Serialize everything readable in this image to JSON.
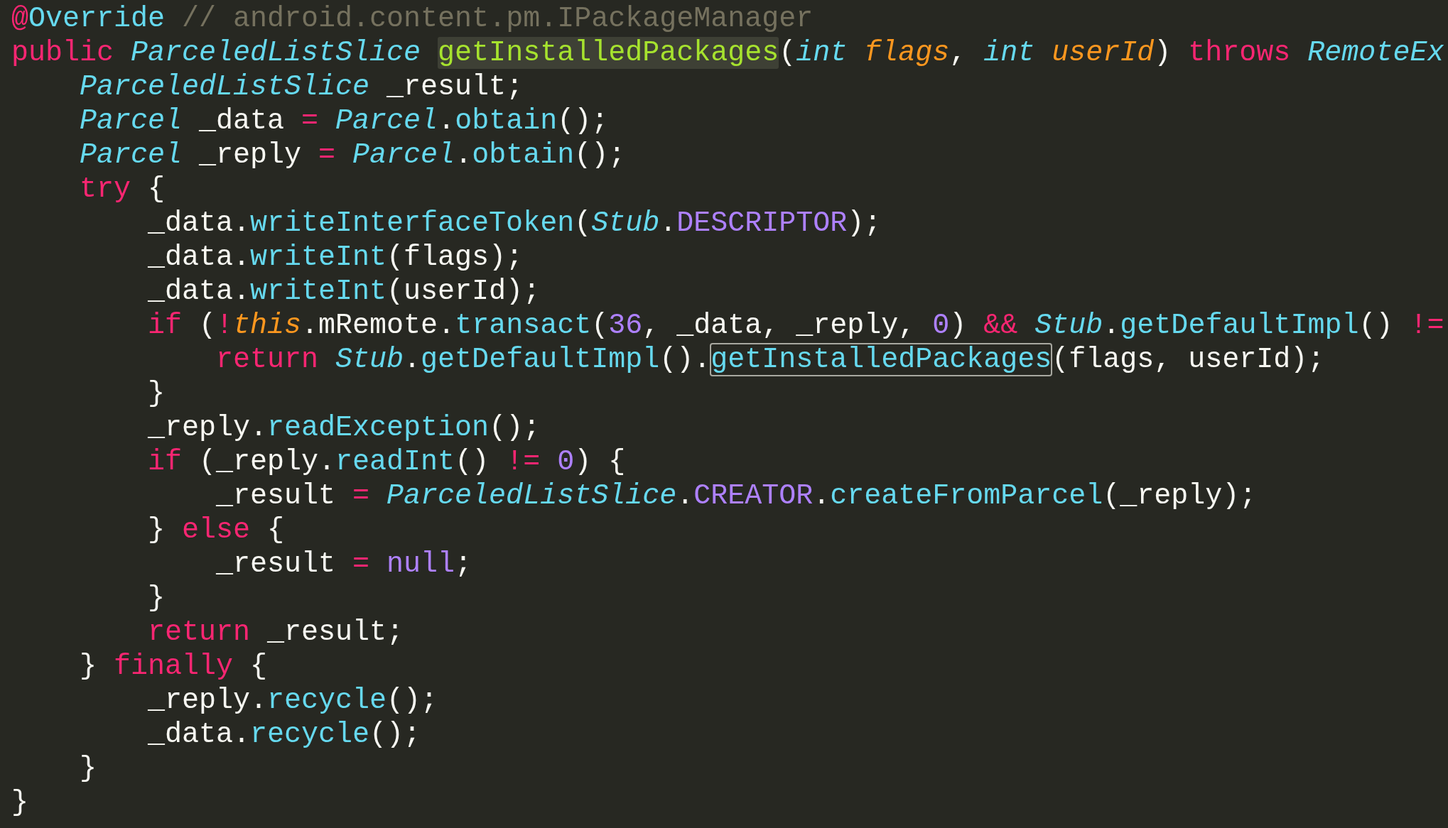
{
  "editor": {
    "lines": [
      {
        "tokens": [
          {
            "text": "@",
            "kind": "keyword"
          },
          {
            "text": "Override",
            "kind": "call"
          },
          {
            "text": " // android.content.pm.IPackageManager",
            "kind": "comment"
          }
        ]
      },
      {
        "tokens": [
          {
            "text": "public ",
            "kind": "keyword"
          },
          {
            "text": "ParceledListSlice ",
            "kind": "type"
          },
          {
            "text": "getInstalledPackages",
            "kind": "decl-selected"
          },
          {
            "text": "(",
            "kind": "plain"
          },
          {
            "text": "int ",
            "kind": "type"
          },
          {
            "text": "flags",
            "kind": "param"
          },
          {
            "text": ", ",
            "kind": "plain"
          },
          {
            "text": "int ",
            "kind": "type"
          },
          {
            "text": "userId",
            "kind": "param"
          },
          {
            "text": ") ",
            "kind": "plain"
          },
          {
            "text": "throws ",
            "kind": "keyword"
          },
          {
            "text": "RemoteEx",
            "kind": "type"
          }
        ],
        "children": [
          {
            "tokens": [
              {
                "text": "ParceledListSlice",
                "kind": "type"
              },
              {
                "text": " _result;",
                "kind": "plain"
              }
            ]
          },
          {
            "tokens": [
              {
                "text": "Parcel",
                "kind": "type"
              },
              {
                "text": " _data ",
                "kind": "plain"
              },
              {
                "text": "= ",
                "kind": "keyword"
              },
              {
                "text": "Parcel",
                "kind": "type"
              },
              {
                "text": ".",
                "kind": "plain"
              },
              {
                "text": "obtain",
                "kind": "call"
              },
              {
                "text": "();",
                "kind": "plain"
              }
            ]
          },
          {
            "tokens": [
              {
                "text": "Parcel",
                "kind": "type"
              },
              {
                "text": " _reply ",
                "kind": "plain"
              },
              {
                "text": "= ",
                "kind": "keyword"
              },
              {
                "text": "Parcel",
                "kind": "type"
              },
              {
                "text": ".",
                "kind": "plain"
              },
              {
                "text": "obtain",
                "kind": "call"
              },
              {
                "text": "();",
                "kind": "plain"
              }
            ]
          },
          {
            "tokens": [
              {
                "text": "try",
                "kind": "keyword"
              },
              {
                "text": " {",
                "kind": "plain"
              }
            ],
            "children": [
              {
                "tokens": [
                  {
                    "text": "_data.",
                    "kind": "plain"
                  },
                  {
                    "text": "writeInterfaceToken",
                    "kind": "call"
                  },
                  {
                    "text": "(",
                    "kind": "plain"
                  },
                  {
                    "text": "Stub",
                    "kind": "type"
                  },
                  {
                    "text": ".",
                    "kind": "plain"
                  },
                  {
                    "text": "DESCRIPTOR",
                    "kind": "constant"
                  },
                  {
                    "text": ");",
                    "kind": "plain"
                  }
                ]
              },
              {
                "tokens": [
                  {
                    "text": "_data.",
                    "kind": "plain"
                  },
                  {
                    "text": "writeInt",
                    "kind": "call"
                  },
                  {
                    "text": "(flags);",
                    "kind": "plain"
                  }
                ]
              },
              {
                "tokens": [
                  {
                    "text": "_data.",
                    "kind": "plain"
                  },
                  {
                    "text": "writeInt",
                    "kind": "call"
                  },
                  {
                    "text": "(userId);",
                    "kind": "plain"
                  }
                ]
              },
              {
                "tokens": [
                  {
                    "text": "if",
                    "kind": "keyword"
                  },
                  {
                    "text": " (",
                    "kind": "plain"
                  },
                  {
                    "text": "!",
                    "kind": "keyword"
                  },
                  {
                    "text": "this",
                    "kind": "param"
                  },
                  {
                    "text": ".mRemote.",
                    "kind": "plain"
                  },
                  {
                    "text": "transact",
                    "kind": "call"
                  },
                  {
                    "text": "(",
                    "kind": "plain"
                  },
                  {
                    "text": "36",
                    "kind": "constant"
                  },
                  {
                    "text": ", _data, _reply, ",
                    "kind": "plain"
                  },
                  {
                    "text": "0",
                    "kind": "constant"
                  },
                  {
                    "text": ") ",
                    "kind": "plain"
                  },
                  {
                    "text": "&& ",
                    "kind": "keyword"
                  },
                  {
                    "text": "Stub",
                    "kind": "type"
                  },
                  {
                    "text": ".",
                    "kind": "plain"
                  },
                  {
                    "text": "getDefaultImpl",
                    "kind": "call"
                  },
                  {
                    "text": "() ",
                    "kind": "plain"
                  },
                  {
                    "text": "!=",
                    "kind": "keyword"
                  }
                ],
                "children": [
                  {
                    "tokens": [
                      {
                        "text": "return ",
                        "kind": "keyword"
                      },
                      {
                        "text": "Stub",
                        "kind": "type"
                      },
                      {
                        "text": ".",
                        "kind": "plain"
                      },
                      {
                        "text": "getDefaultImpl",
                        "kind": "call"
                      },
                      {
                        "text": "().",
                        "kind": "plain"
                      },
                      {
                        "text": "getInstalledPackages",
                        "kind": "call-outlined"
                      },
                      {
                        "text": "(flags, userId);",
                        "kind": "plain"
                      }
                    ]
                  }
                ]
              },
              {
                "tokens": [
                  {
                    "text": "}",
                    "kind": "plain"
                  }
                ]
              },
              {
                "tokens": [
                  {
                    "text": "_reply.",
                    "kind": "plain"
                  },
                  {
                    "text": "readException",
                    "kind": "call"
                  },
                  {
                    "text": "();",
                    "kind": "plain"
                  }
                ]
              },
              {
                "tokens": [
                  {
                    "text": "if",
                    "kind": "keyword"
                  },
                  {
                    "text": " (_reply.",
                    "kind": "plain"
                  },
                  {
                    "text": "readInt",
                    "kind": "call"
                  },
                  {
                    "text": "() ",
                    "kind": "plain"
                  },
                  {
                    "text": "!= ",
                    "kind": "keyword"
                  },
                  {
                    "text": "0",
                    "kind": "constant"
                  },
                  {
                    "text": ") {",
                    "kind": "plain"
                  }
                ],
                "children": [
                  {
                    "tokens": [
                      {
                        "text": "_result ",
                        "kind": "plain"
                      },
                      {
                        "text": "= ",
                        "kind": "keyword"
                      },
                      {
                        "text": "ParceledListSlice",
                        "kind": "type"
                      },
                      {
                        "text": ".",
                        "kind": "plain"
                      },
                      {
                        "text": "CREATOR",
                        "kind": "constant"
                      },
                      {
                        "text": ".",
                        "kind": "plain"
                      },
                      {
                        "text": "createFromParcel",
                        "kind": "call"
                      },
                      {
                        "text": "(_reply);",
                        "kind": "plain"
                      }
                    ]
                  }
                ]
              },
              {
                "tokens": [
                  {
                    "text": "} ",
                    "kind": "plain"
                  },
                  {
                    "text": "else",
                    "kind": "keyword"
                  },
                  {
                    "text": " {",
                    "kind": "plain"
                  }
                ],
                "children": [
                  {
                    "tokens": [
                      {
                        "text": "_result ",
                        "kind": "plain"
                      },
                      {
                        "text": "= ",
                        "kind": "keyword"
                      },
                      {
                        "text": "null",
                        "kind": "constant"
                      },
                      {
                        "text": ";",
                        "kind": "plain"
                      }
                    ]
                  }
                ]
              },
              {
                "tokens": [
                  {
                    "text": "}",
                    "kind": "plain"
                  }
                ]
              },
              {
                "tokens": [
                  {
                    "text": "return",
                    "kind": "keyword"
                  },
                  {
                    "text": " _result;",
                    "kind": "plain"
                  }
                ]
              }
            ]
          },
          {
            "tokens": [
              {
                "text": "} ",
                "kind": "plain"
              },
              {
                "text": "finally",
                "kind": "keyword"
              },
              {
                "text": " {",
                "kind": "plain"
              }
            ],
            "children": [
              {
                "tokens": [
                  {
                    "text": "_reply.",
                    "kind": "plain"
                  },
                  {
                    "text": "recycle",
                    "kind": "call"
                  },
                  {
                    "text": "();",
                    "kind": "plain"
                  }
                ]
              },
              {
                "tokens": [
                  {
                    "text": "_data.",
                    "kind": "plain"
                  },
                  {
                    "text": "recycle",
                    "kind": "call"
                  },
                  {
                    "text": "();",
                    "kind": "plain"
                  }
                ]
              }
            ]
          },
          {
            "tokens": [
              {
                "text": "}",
                "kind": "plain"
              }
            ]
          }
        ]
      },
      {
        "tokens": [
          {
            "text": "}",
            "kind": "plain"
          }
        ]
      }
    ]
  }
}
